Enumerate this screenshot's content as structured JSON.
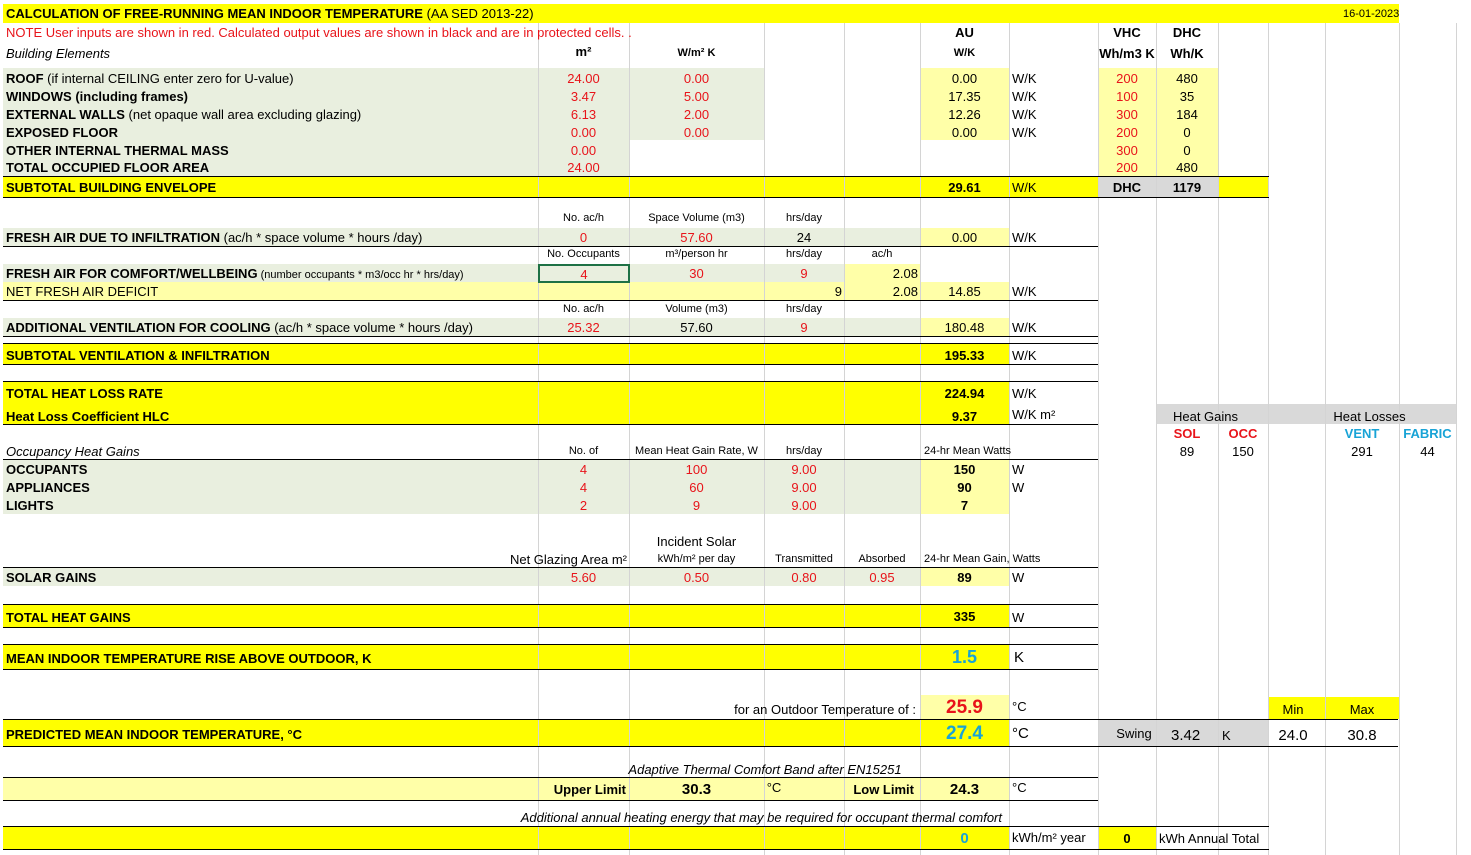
{
  "title": "CALCULATION OF FREE-RUNNING MEAN INDOOR TEMPERATURE",
  "title_suffix": "(AA SED 2013-22)",
  "date": "16-01-2023",
  "note": "NOTE User inputs are shown in red. Calculated output values are shown in black and are in protected cells. .",
  "headers": {
    "building_elements": "Building Elements",
    "m2": "m²",
    "wm2k": "W/m² K",
    "au": "AU",
    "wk": "W/K",
    "vhc": "VHC",
    "vhc_unit": "Wh/m3 K",
    "dhc": "DHC",
    "dhc_unit": "Wh/K"
  },
  "elements": [
    {
      "bold": "ROOF",
      "rest": " (if internal CEILING enter zero for U-value)",
      "area": "24.00",
      "u": "0.00",
      "au": "0.00",
      "unit": "W/K",
      "vhc": "200",
      "dhc": "480"
    },
    {
      "bold": "WINDOWS (including frames)",
      "rest": "",
      "area": "3.47",
      "u": "5.00",
      "au": "17.35",
      "unit": "W/K",
      "vhc": "100",
      "dhc": "35"
    },
    {
      "bold": "EXTERNAL WALLS",
      "rest": " (net opaque wall area excluding glazing)",
      "area": "6.13",
      "u": "2.00",
      "au": "12.26",
      "unit": "W/K",
      "vhc": "300",
      "dhc": "184"
    },
    {
      "bold": "EXPOSED FLOOR",
      "rest": "",
      "area": "0.00",
      "u": "0.00",
      "au": "0.00",
      "unit": "W/K",
      "vhc": "200",
      "dhc": "0"
    },
    {
      "bold": "OTHER INTERNAL THERMAL MASS",
      "rest": "",
      "area": "0.00",
      "u": "",
      "au": "",
      "unit": "",
      "vhc": "300",
      "dhc": "0"
    },
    {
      "bold": "TOTAL OCCUPIED FLOOR AREA",
      "rest": "",
      "area": "24.00",
      "u": "",
      "au": "",
      "unit": "",
      "vhc": "200",
      "dhc": "480"
    }
  ],
  "subtotal_envelope": {
    "label": "SUBTOTAL BUILDING ENVELOPE",
    "value": "29.61",
    "unit": "W/K",
    "dhc_label": "DHC",
    "dhc_value": "1179"
  },
  "infiltration": {
    "h1": "No. ac/h",
    "h2": "Space Volume (m3)",
    "h3": "hrs/day",
    "label_bold": "FRESH AIR DUE TO INFILTRATION",
    "label_rest": " (ac/h *  space volume * hours /day)",
    "ach": "0",
    "volume": "57.60",
    "hrs": "24",
    "value": "0.00",
    "unit": "W/K"
  },
  "comfort": {
    "h1": "No. Occupants",
    "h2": "m³/person hr",
    "h3": "hrs/day",
    "h4": "ac/h",
    "label_bold": "FRESH AIR FOR COMFORT/WELLBEING",
    "label_rest": " (number occupants * m3/occ hr * hrs/day)",
    "occupants": "4",
    "rate": "30",
    "hrs": "9",
    "ach": "2.08"
  },
  "net_deficit": {
    "label": "NET FRESH AIR DEFICIT",
    "hrs": "9",
    "ach": "2.08",
    "value": "14.85",
    "unit": "W/K"
  },
  "cooling": {
    "h1": "No. ac/h",
    "h2": "Volume (m3)",
    "h3": "hrs/day",
    "label_bold": "ADDITIONAL VENTILATION FOR COOLING",
    "label_rest": " (ac/h * space volume * hours /day)",
    "ach": "25.32",
    "volume": "57.60",
    "hrs": "9",
    "value": "180.48",
    "unit": "W/K"
  },
  "subtotal_vent": {
    "label": "SUBTOTAL VENTILATION & INFILTRATION",
    "value": "195.33",
    "unit": "W/K"
  },
  "total_heat_loss": {
    "label": "TOTAL HEAT LOSS RATE",
    "value": "224.94",
    "unit": "W/K"
  },
  "hlc": {
    "label": "Heat Loss Coefficient HLC",
    "value": "9.37",
    "unit": "W/K m²"
  },
  "summary": {
    "gains_title": "Heat Gains",
    "losses_title": "Heat Losses",
    "sol_label": "SOL",
    "occ_label": "OCC",
    "vent_label": "VENT",
    "fabric_label": "FABRIC",
    "sol": "89",
    "occ": "150",
    "vent": "291",
    "fabric": "44"
  },
  "occupancy": {
    "title": "Occupancy Heat Gains",
    "h1": "No. of",
    "h2": "Mean Heat Gain Rate, W",
    "h3": "hrs/day",
    "h4": "24-hr Mean Watts",
    "rows": [
      {
        "label": "OCCUPANTS",
        "num": "4",
        "rate": "100",
        "hrs": "9.00",
        "watts": "150",
        "unit": "W"
      },
      {
        "label": "APPLIANCES",
        "num": "4",
        "rate": "60",
        "hrs": "9.00",
        "watts": "90",
        "unit": "W"
      },
      {
        "label": "LIGHTS",
        "num": "2",
        "rate": "9",
        "hrs": "9.00",
        "watts": "7",
        "unit": ""
      }
    ]
  },
  "solar": {
    "incident_h": "Incident Solar",
    "h1": "Net Glazing Area  m²",
    "h2": "kWh/m² per day",
    "h3": "Transmitted",
    "h4": "Absorbed",
    "h5": "24-hr Mean Gain, Watts",
    "label": "SOLAR GAINS",
    "area": "5.60",
    "incident": "0.50",
    "transmitted": "0.80",
    "absorbed": "0.95",
    "value": "89",
    "unit": "W"
  },
  "total_gains": {
    "label": "TOTAL HEAT GAINS",
    "value": "335",
    "unit": "W"
  },
  "rise": {
    "label": "MEAN INDOOR TEMPERATURE RISE ABOVE OUTDOOR, K",
    "value": "1.5",
    "unit": "K"
  },
  "outdoor": {
    "label": "for an Outdoor Temperature of :",
    "value": "25.9",
    "unit": "°C"
  },
  "predicted": {
    "label": "PREDICTED MEAN INDOOR TEMPERATURE, °C",
    "value": "27.4",
    "unit": "°C",
    "swing_label": "Swing",
    "swing": "3.42",
    "swing_unit": "K",
    "min_label": "Min",
    "max_label": "Max",
    "min": "24.0",
    "max": "30.8"
  },
  "adaptive": {
    "title": "Adaptive Thermal Comfort Band after EN15251",
    "upper_label": "Upper Limit",
    "upper": "30.3",
    "upper_unit": "°C",
    "low_label": "Low Limit",
    "low": "24.3",
    "low_unit": "°C"
  },
  "heating": {
    "title": "Additional annual heating energy that may be required for occupant thermal comfort",
    "value": "0",
    "unit": "kWh/m² year",
    "total": "0",
    "total_label": "kWh Annual Total"
  }
}
